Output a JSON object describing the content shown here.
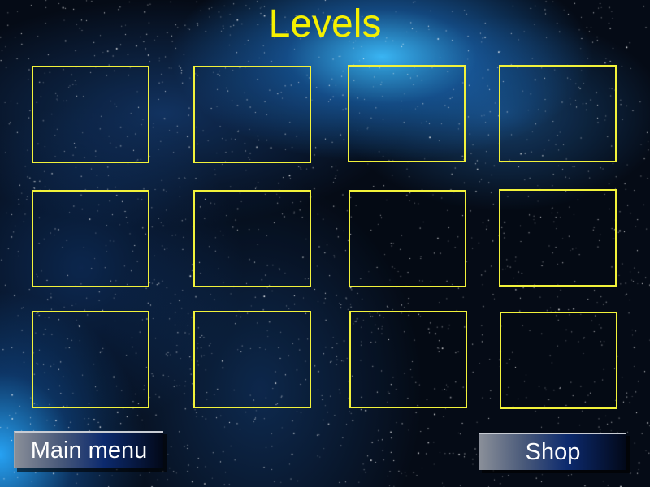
{
  "title": "Levels",
  "level_slots": 12,
  "colors": {
    "title": "#f5f000",
    "slot_border": "#f2f23a"
  },
  "buttons": {
    "main_menu": "Main menu",
    "shop": "Shop"
  }
}
